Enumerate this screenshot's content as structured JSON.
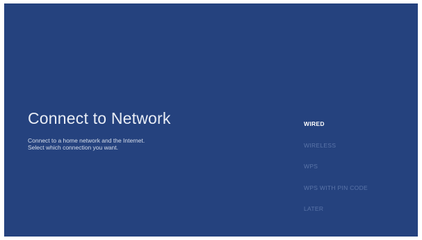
{
  "setup": {
    "title": "Connect to Network",
    "description_line1": "Connect to a home network and the Internet.",
    "description_line2": "Select which connection you want."
  },
  "options": {
    "selected": "WIRED",
    "items": [
      {
        "label": "WIRED"
      },
      {
        "label": "WIRELESS"
      },
      {
        "label": "WPS"
      },
      {
        "label": "WPS WITH PIN CODE"
      },
      {
        "label": "LATER"
      }
    ]
  },
  "colors": {
    "background": "#25427e",
    "selected_text": "#ffffff",
    "unselected_text": "#5a74a8"
  }
}
